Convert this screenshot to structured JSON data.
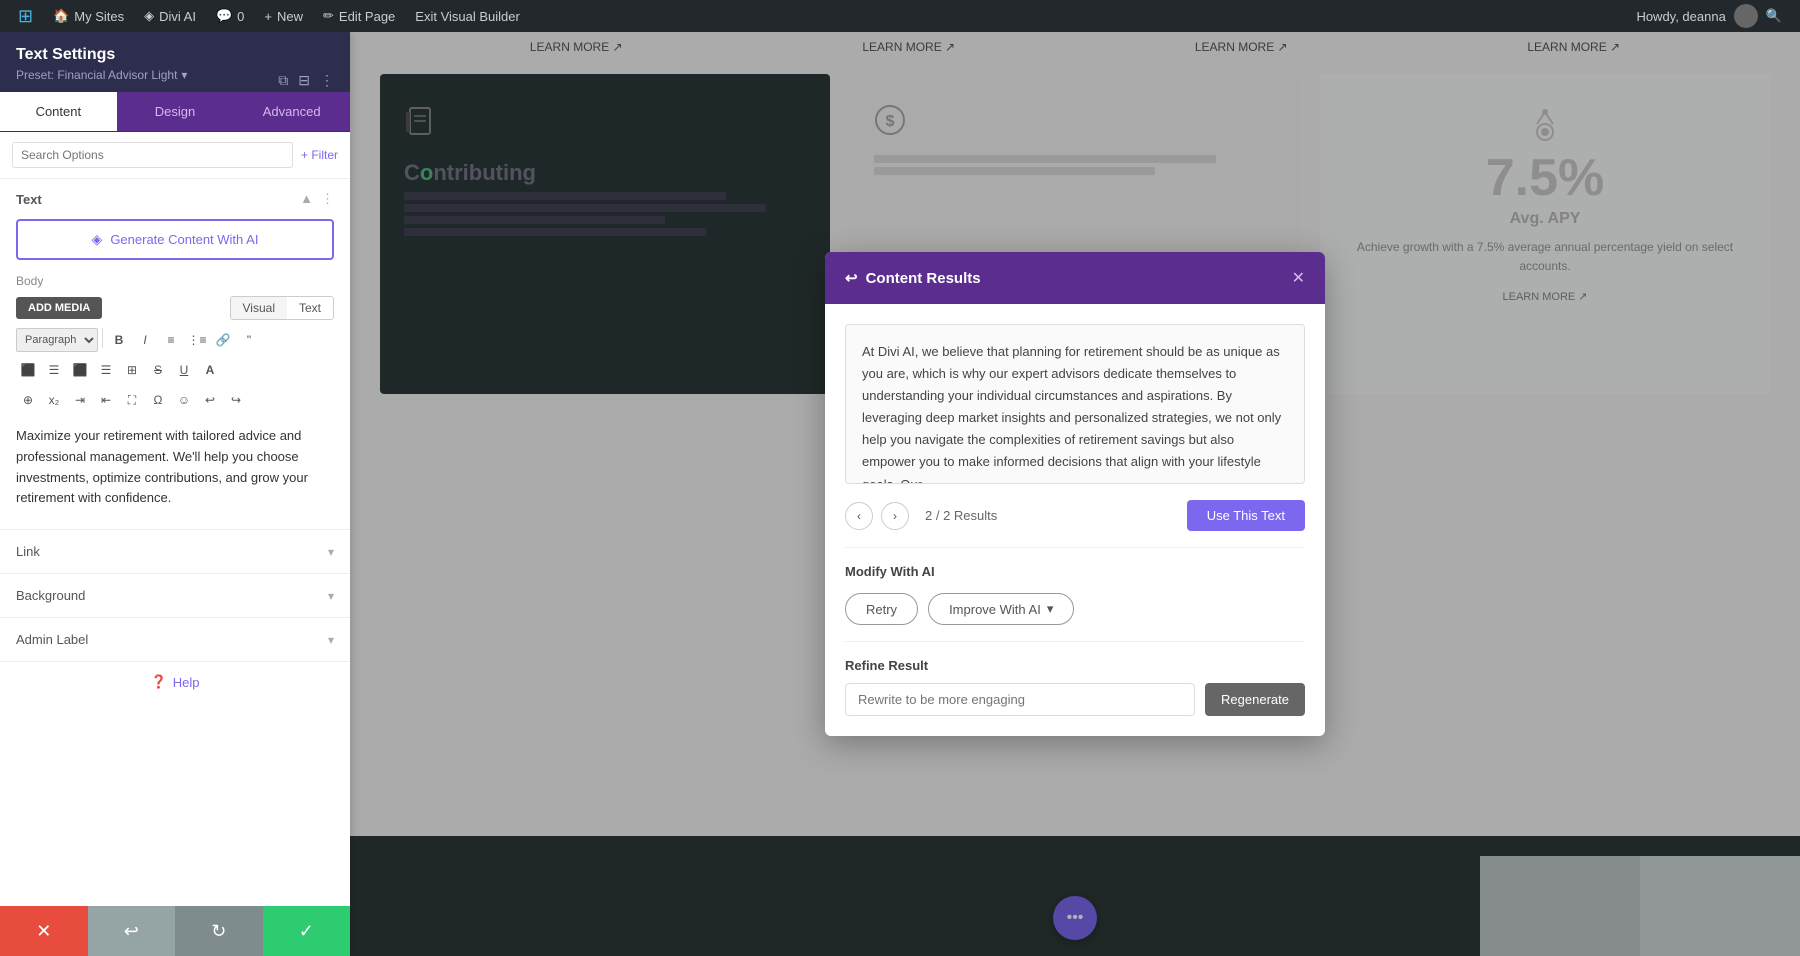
{
  "admin_bar": {
    "wp_logo": "⊞",
    "my_sites": "My Sites",
    "divi_ai": "Divi AI",
    "comments": "0",
    "new": "New",
    "edit_page": "Edit Page",
    "exit_builder": "Exit Visual Builder",
    "howdy": "Howdy, deanna",
    "search_icon": "🔍"
  },
  "sidebar": {
    "title": "Text Settings",
    "preset": "Preset: Financial Advisor Light",
    "tabs": [
      "Content",
      "Design",
      "Advanced"
    ],
    "active_tab": "Content",
    "search_placeholder": "Search Options",
    "filter_label": "+ Filter",
    "section_text": "Text",
    "ai_button_label": "Generate Content With AI",
    "body_label": "Body",
    "add_media": "ADD MEDIA",
    "visual_tab": "Visual",
    "text_tab": "Text",
    "paragraph_select": "Paragraph",
    "text_content": "Maximize your retirement with tailored advice and professional management. We'll help you choose investments, optimize contributions, and grow your retirement with confidence.",
    "link_label": "Link",
    "background_label": "Background",
    "admin_label": "Admin Label",
    "help_label": "Help"
  },
  "modal": {
    "title": "Content Results",
    "back_icon": "↩",
    "close_icon": "✕",
    "content_text": "At Divi AI, we believe that planning for retirement should be as unique as you are, which is why our expert advisors dedicate themselves to understanding your individual circumstances and aspirations. By leveraging deep market insights and personalized strategies, we not only help you navigate the complexities of retirement savings but also empower you to make informed decisions that align with your lifestyle goals. Our",
    "nav_prev": "‹",
    "nav_next": "›",
    "nav_count": "2 / 2 Results",
    "use_text_btn": "Use This Text",
    "modify_ai_label": "Modify With AI",
    "retry_label": "Retry",
    "improve_label": "Improve With AI",
    "improve_chevron": "▾",
    "refine_label": "Refine Result",
    "refine_placeholder": "Rewrite to be more engaging",
    "regenerate_label": "Regenerate"
  },
  "page": {
    "learn_more_links": [
      "LEARN MORE ↗",
      "LEARN MORE ↗",
      "LEARN MORE ↗",
      "LEARN MORE ↗"
    ],
    "card_apy": "7.5%",
    "card_apy_label": "Avg. APY",
    "card_apy_text": "Achieve growth with a 7.5% average annual percentage yield on select accounts.",
    "card_learn_more": "LEARN MORE ↗",
    "fab_icon": "•••"
  },
  "bottom_bar": {
    "cancel": "✕",
    "undo": "↩",
    "redo": "↻",
    "confirm": "✓"
  }
}
